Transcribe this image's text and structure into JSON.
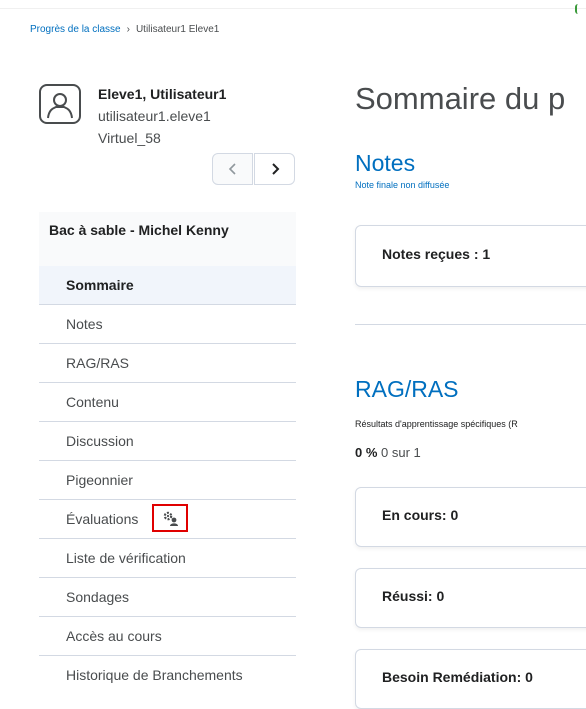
{
  "breadcrumb": {
    "parent": "Progrès de la classe",
    "current": "Utilisateur1 Eleve1"
  },
  "user": {
    "name": "Eleve1, Utilisateur1",
    "login": "utilisateur1.eleve1",
    "org": "Virtuel_58"
  },
  "pager": {
    "prev_icon": "chevron-left-icon",
    "next_icon": "chevron-right-icon"
  },
  "sidebar": {
    "course": "Bac à sable - Michel Kenny",
    "items": [
      {
        "label": "Sommaire",
        "active": true
      },
      {
        "label": "Notes"
      },
      {
        "label": "RAG/RAS"
      },
      {
        "label": "Contenu"
      },
      {
        "label": "Discussion"
      },
      {
        "label": "Pigeonnier"
      },
      {
        "label": "Évaluations",
        "icon": "gear-user-icon"
      },
      {
        "label": "Liste de vérification"
      },
      {
        "label": "Sondages"
      },
      {
        "label": "Accès au cours"
      },
      {
        "label": "Historique de Branchements"
      }
    ]
  },
  "main": {
    "title": "Sommaire du p",
    "notes": {
      "heading": "Notes",
      "sub": "Note finale non diffusée",
      "card": "Notes reçues : 1"
    },
    "rag": {
      "heading": "RAG/RAS",
      "sub": "Résultats d'apprentissage spécifiques (R",
      "percent": "0 %",
      "count": "0 sur 1",
      "cards": [
        "En cours: 0",
        "Réussi: 0",
        "Besoin Remédiation: 0"
      ]
    }
  },
  "colors": {
    "link": "#006fbf",
    "highlight": "#e00000",
    "active_bg": "#f1f5fb"
  }
}
